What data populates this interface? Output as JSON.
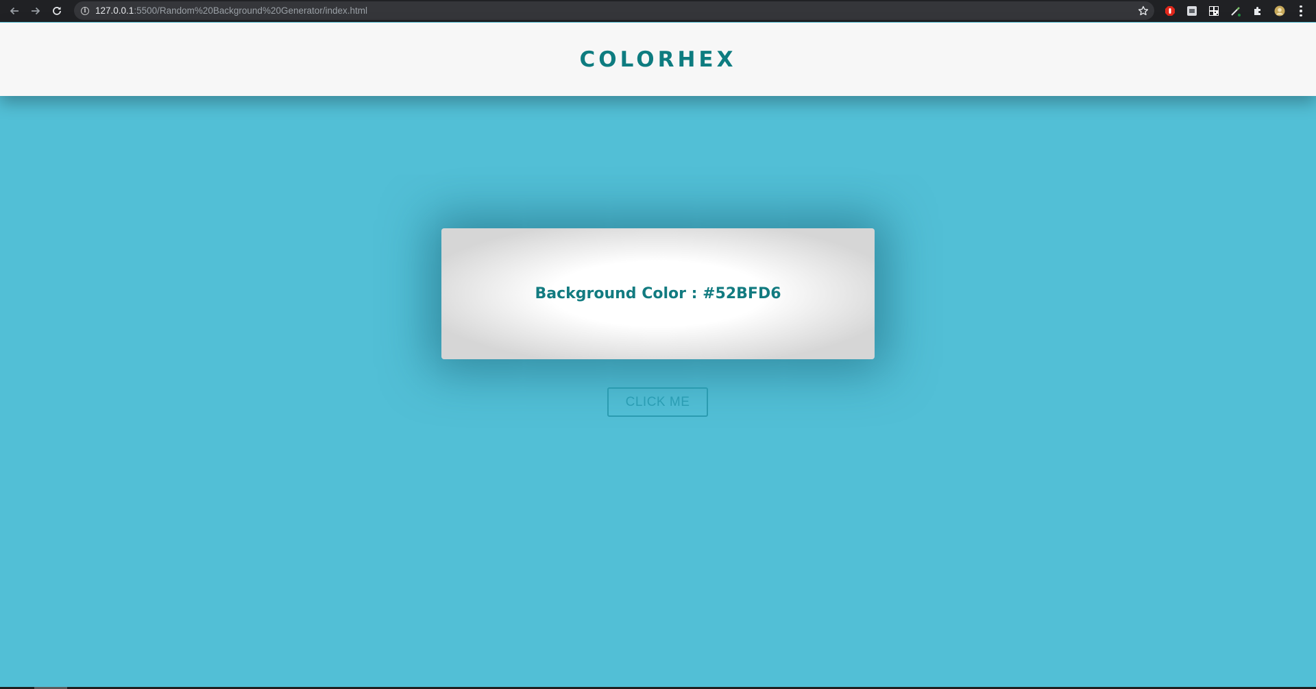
{
  "browser": {
    "url_host": "127.0.0.1",
    "url_rest": ":5500/Random%20Background%20Generator/index.html",
    "back_icon": "arrow-left-icon",
    "forward_icon": "arrow-right-icon",
    "reload_icon": "reload-icon",
    "info_icon": "info-icon",
    "bookmark_icon": "star-icon",
    "extensions": [
      "adblock-icon",
      "screenshot-icon",
      "qr-code-icon",
      "color-picker-icon",
      "puzzle-icon",
      "avatar-icon"
    ],
    "menu_icon": "kebab-menu-icon"
  },
  "header": {
    "title": "COLORHEX"
  },
  "card": {
    "label": "Background Color : #52BFD6"
  },
  "button": {
    "label": "CLICK ME"
  },
  "colors": {
    "page_background": "#52BFD6",
    "accent_text": "#0E7C80",
    "header_background": "#F7F7F7",
    "button_border": "#2B9BB0"
  }
}
